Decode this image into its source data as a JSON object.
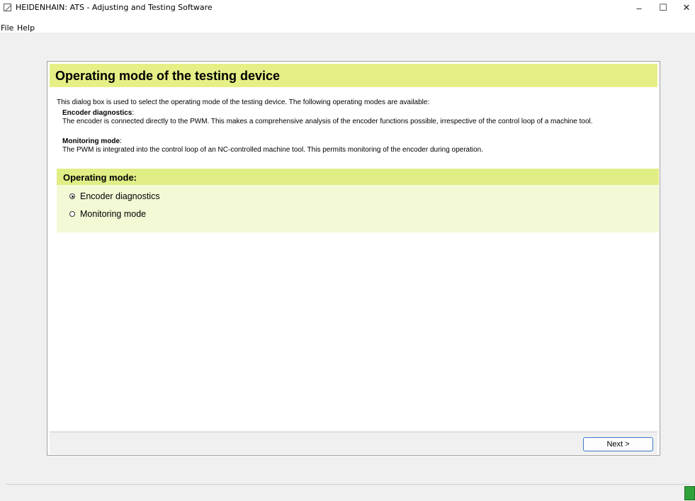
{
  "window": {
    "title": "HEIDENHAIN: ATS - Adjusting and Testing Software",
    "minimize_glyph": "–",
    "maximize_glyph": "☐",
    "close_glyph": "✕"
  },
  "menu": {
    "items": [
      {
        "label": "File"
      },
      {
        "label": "Help"
      }
    ]
  },
  "dialog": {
    "title": "Operating mode of the testing device",
    "intro": "This dialog box is used to select the operating mode of the testing device. The following operating modes are available:",
    "modes": [
      {
        "title": "Encoder diagnostics",
        "colon": ":",
        "description": "The encoder is connected directly to the PWM. This makes a comprehensive analysis of the encoder functions possible, irrespective of the control loop of a machine tool."
      },
      {
        "title": "Monitoring mode",
        "colon": ":",
        "description": "The PWM is integrated into the control loop of an NC-controlled machine tool. This permits monitoring of the encoder during operation."
      }
    ],
    "operating_mode_label": "Operating mode:",
    "options": [
      {
        "label": "Encoder diagnostics",
        "selected": true
      },
      {
        "label": "Monitoring mode",
        "selected": false
      }
    ],
    "next_label": "Next >"
  },
  "colors": {
    "header_bar": "#e6ef86",
    "option_bar": "#e1ed85",
    "option_panel": "#f3f9d5",
    "status_icon": "#2fa33a"
  },
  "icons": {
    "app": "heidenhain-logo-icon",
    "status": "connection-status-icon"
  }
}
